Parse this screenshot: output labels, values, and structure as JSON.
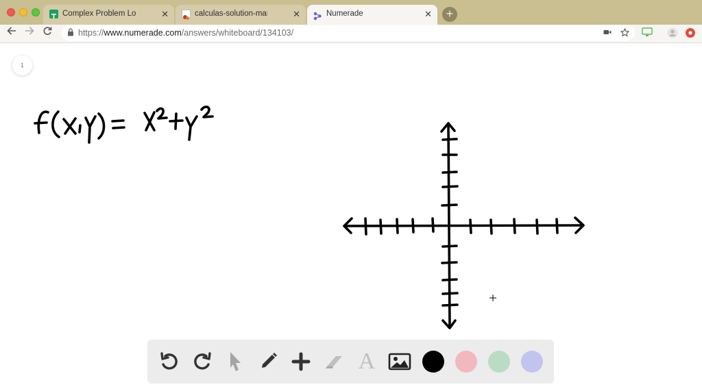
{
  "browser": {
    "tabs": [
      {
        "title": "Complex Problem Log_Brittany",
        "favicon": "google-sheets-icon",
        "active": false
      },
      {
        "title": "calculas-solution-manual-rea",
        "favicon": "pdf-app-icon",
        "active": false
      },
      {
        "title": "Numerade",
        "favicon": "numerade-icon",
        "active": true
      }
    ],
    "close_glyph": "✕",
    "new_tab_glyph": "+",
    "url_scheme": "https://",
    "url_host": "www.numerade.com",
    "url_path": "/answers/whiteboard/134103/"
  },
  "page": {
    "page_number": "1"
  },
  "whiteboard": {
    "equation": "f(x, y) = x² + y²",
    "strokes": [
      "function-definition",
      "coordinate-axes"
    ]
  },
  "drawing_toolbar": {
    "tools": [
      "undo-icon",
      "redo-icon",
      "pointer-icon",
      "pen-icon",
      "add-shape-icon",
      "eraser-icon",
      "text-tool-icon",
      "image-icon"
    ],
    "text_tool_glyph": "A",
    "colors": [
      "#000000",
      "#f1b9bd",
      "#b9dcc3",
      "#c3c3ef"
    ]
  },
  "colors": {
    "tabbar": "#c9bf90",
    "ink": "#000000"
  }
}
